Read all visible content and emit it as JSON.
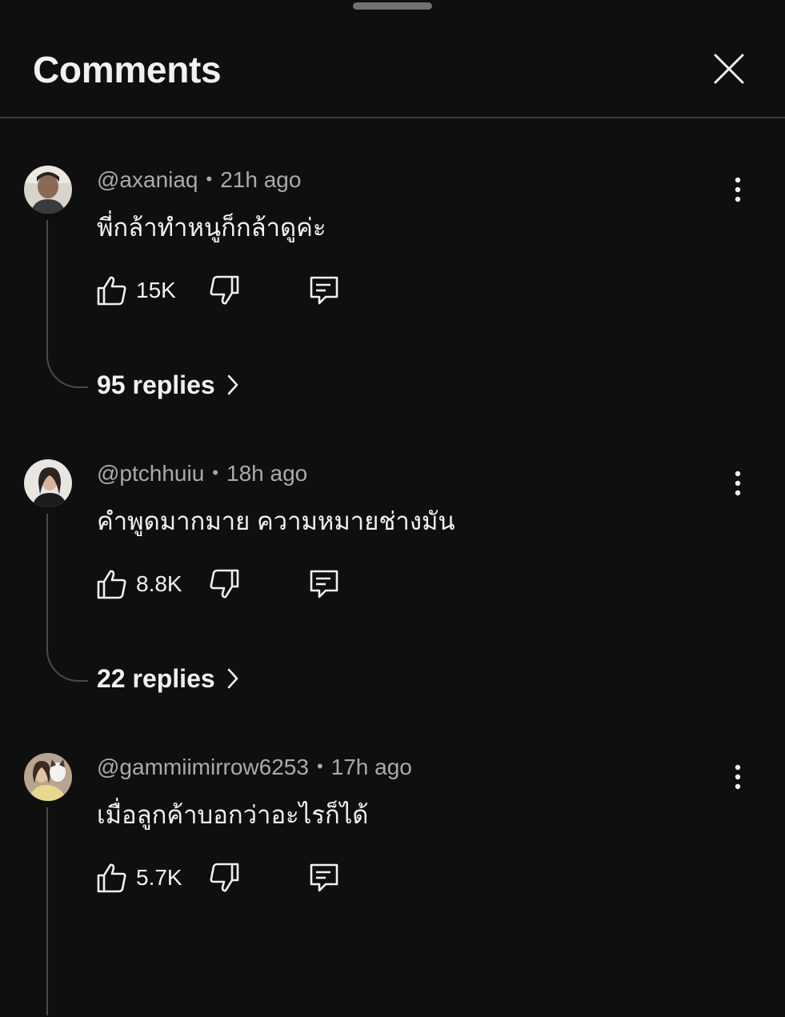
{
  "panel": {
    "title": "Comments"
  },
  "comments": [
    {
      "username": "@axaniaq",
      "time": "21h ago",
      "text": "พี่กล้าทำหนูก็กล้าดูค่ะ",
      "likes": "15K",
      "replies_label": "95 replies"
    },
    {
      "username": "@ptchhuiu",
      "time": "18h ago",
      "text": "คำพูดมากมาย ความหมายช่างมัน",
      "likes": "8.8K",
      "replies_label": "22 replies"
    },
    {
      "username": "@gammiimirrow6253",
      "time": "17h ago",
      "text": "เมื่อลูกค้าบอกว่าอะไรก็ได้",
      "likes": "5.7K",
      "replies_label": null
    }
  ],
  "icons": {
    "close": "close-icon",
    "more": "more-vert-icon",
    "like": "thumb-up-icon",
    "dislike": "thumb-down-icon",
    "reply": "reply-icon",
    "chevron": "chevron-right-icon"
  },
  "colors": {
    "background": "#0f0f0f",
    "primary_text": "#f1f1f1",
    "secondary_text": "#aaaaaa",
    "divider": "#3a3a3a"
  }
}
